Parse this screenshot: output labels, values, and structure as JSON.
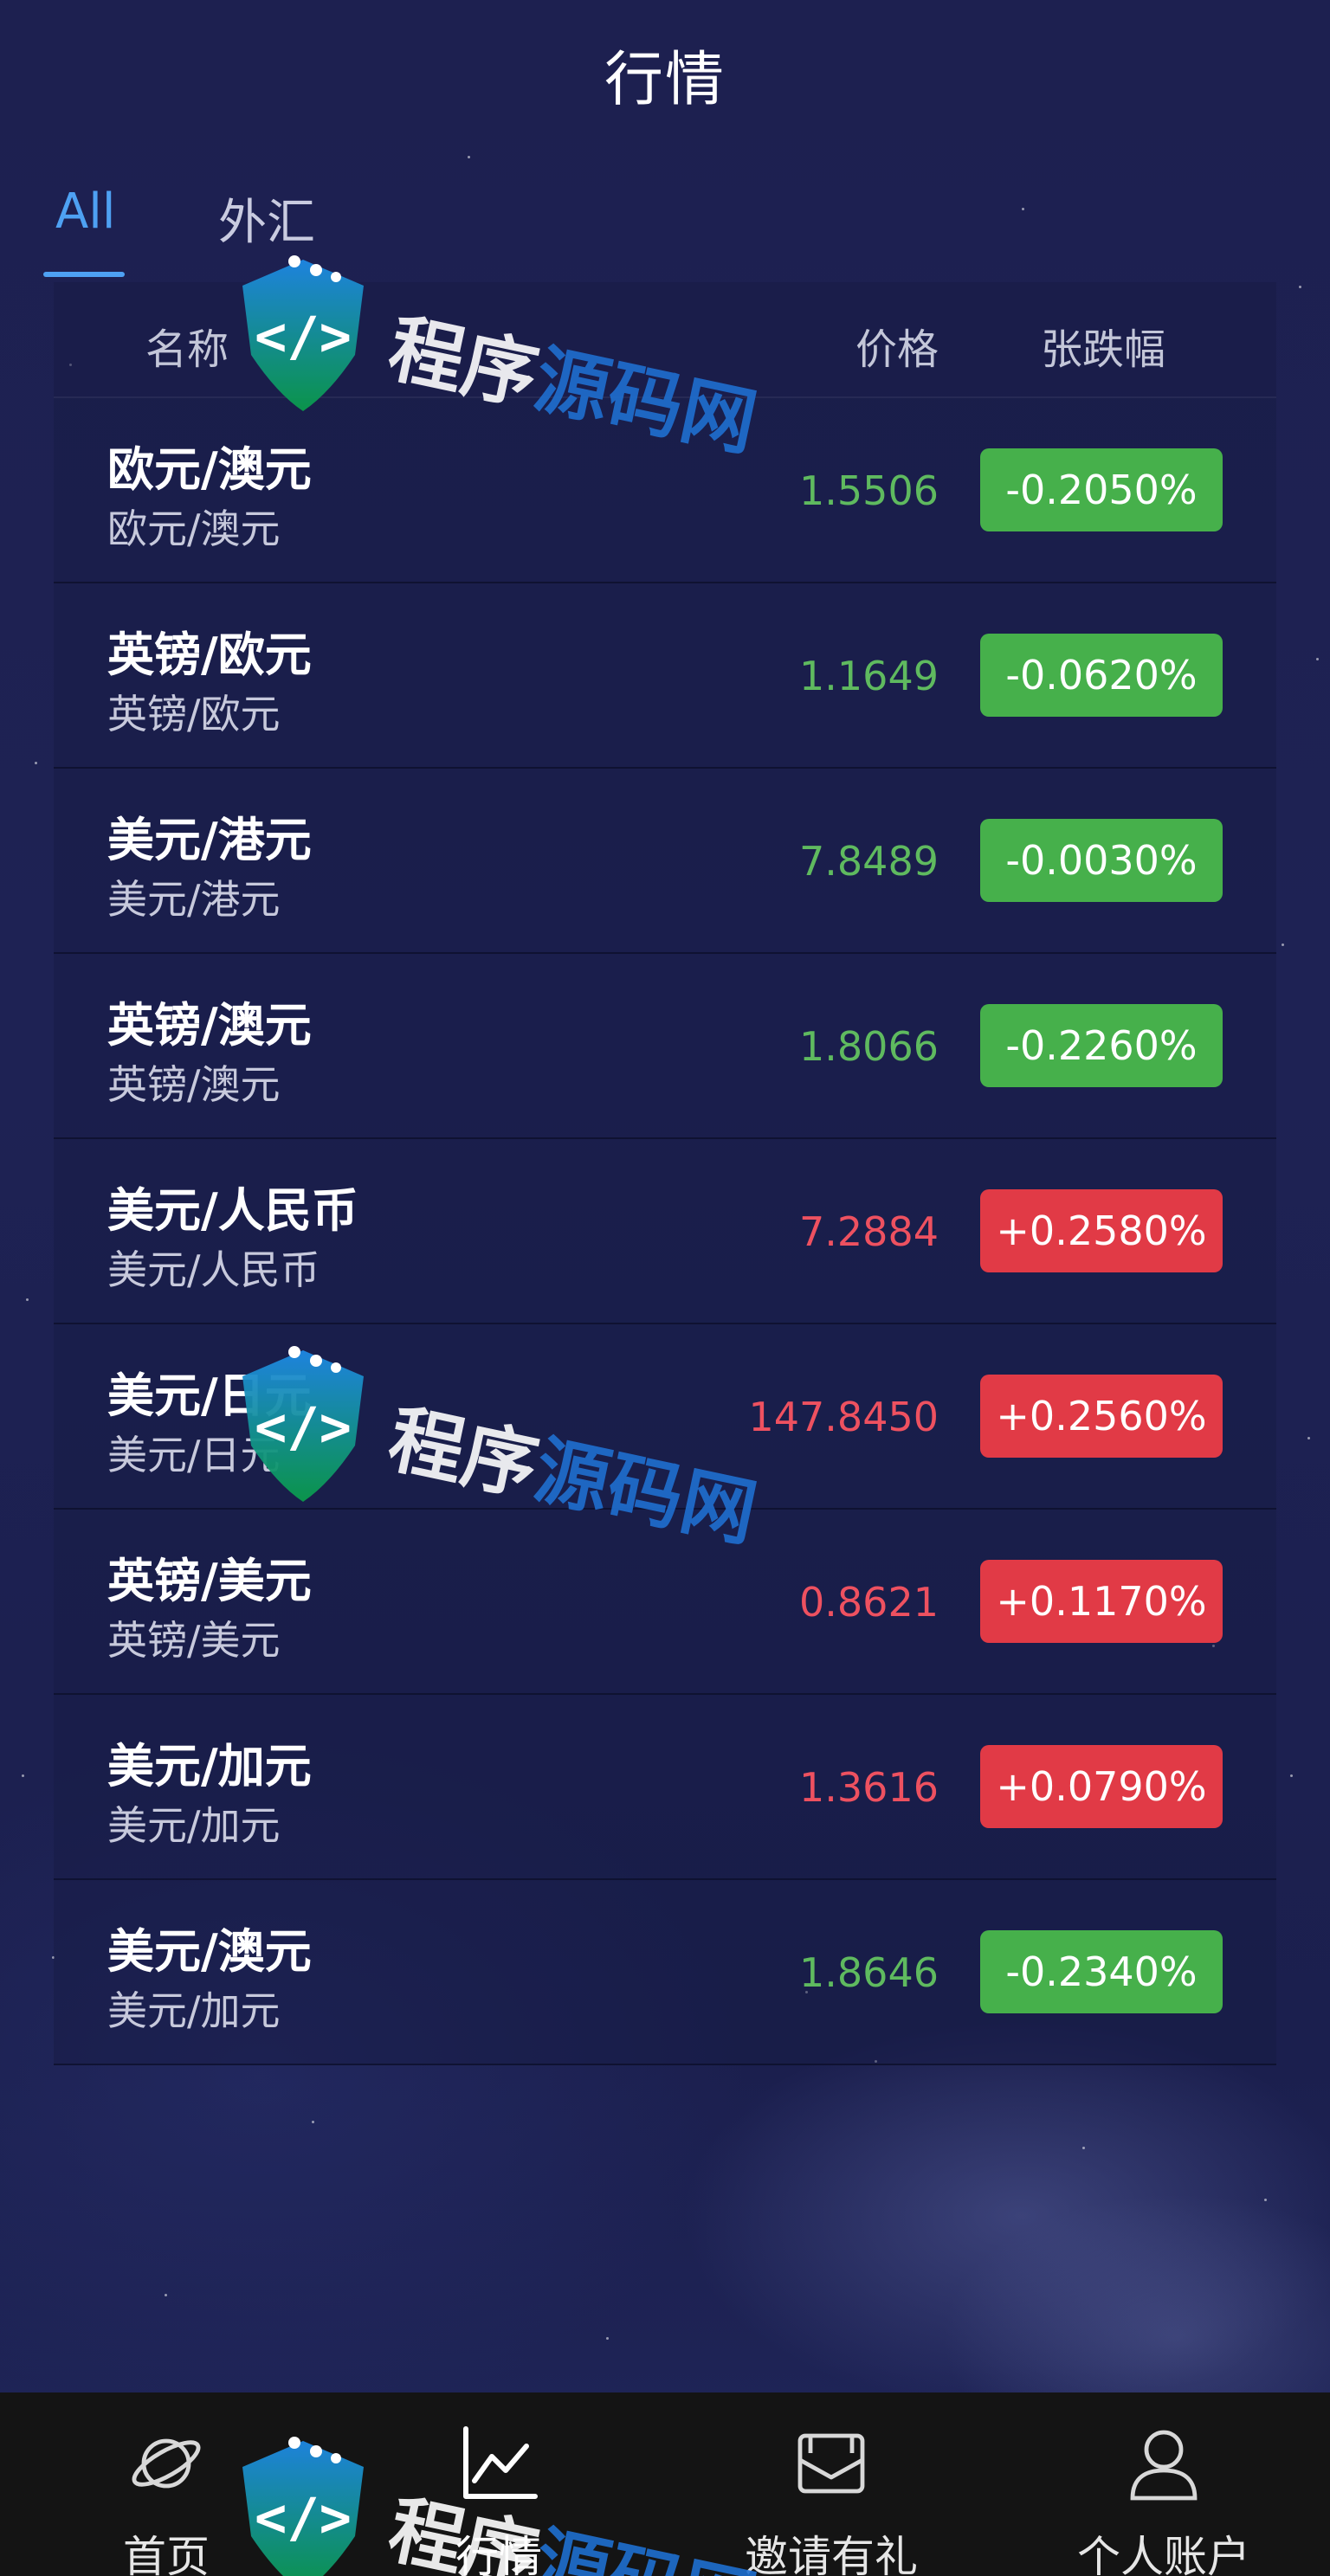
{
  "header": {
    "title": "行情"
  },
  "tabs": [
    {
      "label": "All",
      "active": true
    },
    {
      "label": "外汇",
      "active": false
    }
  ],
  "table": {
    "columns": {
      "name": "名称",
      "price": "价格",
      "change": "张跌幅"
    },
    "rows": [
      {
        "name": "欧元/澳元",
        "sub": "欧元/澳元",
        "price": "1.5506",
        "change": "-0.2050%",
        "direction": "down"
      },
      {
        "name": "英镑/欧元",
        "sub": "英镑/欧元",
        "price": "1.1649",
        "change": "-0.0620%",
        "direction": "down"
      },
      {
        "name": "美元/港元",
        "sub": "美元/港元",
        "price": "7.8489",
        "change": "-0.0030%",
        "direction": "down"
      },
      {
        "name": "英镑/澳元",
        "sub": "英镑/澳元",
        "price": "1.8066",
        "change": "-0.2260%",
        "direction": "down"
      },
      {
        "name": "美元/人民币",
        "sub": "美元/人民币",
        "price": "7.2884",
        "change": "+0.2580%",
        "direction": "up"
      },
      {
        "name": "美元/日元",
        "sub": "美元/日元",
        "price": "147.8450",
        "change": "+0.2560%",
        "direction": "up"
      },
      {
        "name": "英镑/美元",
        "sub": "英镑/美元",
        "price": "0.8621",
        "change": "+0.1170%",
        "direction": "up"
      },
      {
        "name": "美元/加元",
        "sub": "美元/加元",
        "price": "1.3616",
        "change": "+0.0790%",
        "direction": "up"
      },
      {
        "name": "美元/澳元",
        "sub": "美元/加元",
        "price": "1.8646",
        "change": "-0.2340%",
        "direction": "down"
      }
    ]
  },
  "tabbar": {
    "items": [
      {
        "label": "首页",
        "icon": "planet-icon"
      },
      {
        "label": "行情",
        "icon": "chart-line-icon",
        "active": true
      },
      {
        "label": "邀请有礼",
        "icon": "envelope-icon"
      },
      {
        "label": "个人账户",
        "icon": "user-icon"
      }
    ]
  },
  "watermark": {
    "text": "程序源码网"
  },
  "colors": {
    "accent": "#4ea1f3",
    "up": "#e13a46",
    "down": "#46b04b",
    "background": "#1c1f4c",
    "tabbar": "#141414"
  }
}
